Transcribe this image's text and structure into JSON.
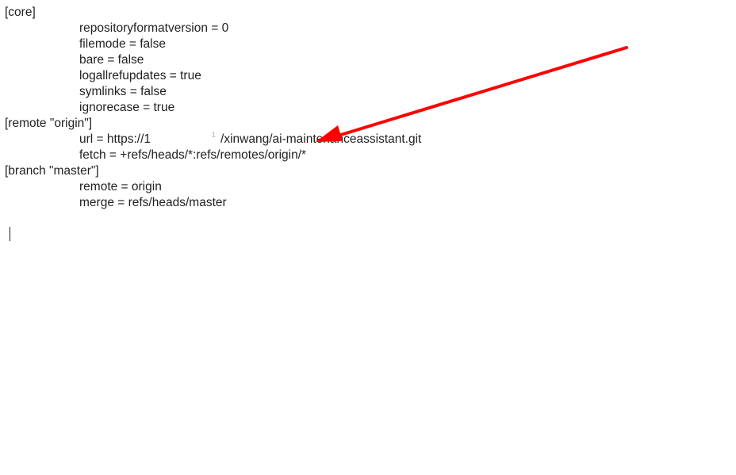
{
  "config": {
    "core": {
      "header": "[core]",
      "repositoryformatversion": "repositoryformatversion = 0",
      "filemode": "filemode = false",
      "bare": "bare = false",
      "logallrefupdates": "logallrefupdates = true",
      "symlinks": "symlinks = false",
      "ignorecase": "ignorecase = true"
    },
    "remote": {
      "header": "[remote \"origin\"]",
      "url_pre": "url = https://1",
      "url_post": "/xinwang/ai-maintenanceassistant.git",
      "fetch": "fetch = +refs/heads/*:refs/remotes/origin/*"
    },
    "branch": {
      "header": "[branch \"master\"]",
      "remote": "remote = origin",
      "merge": "merge = refs/heads/master"
    }
  },
  "annotation": {
    "type": "arrow",
    "color": "#ff0000"
  }
}
